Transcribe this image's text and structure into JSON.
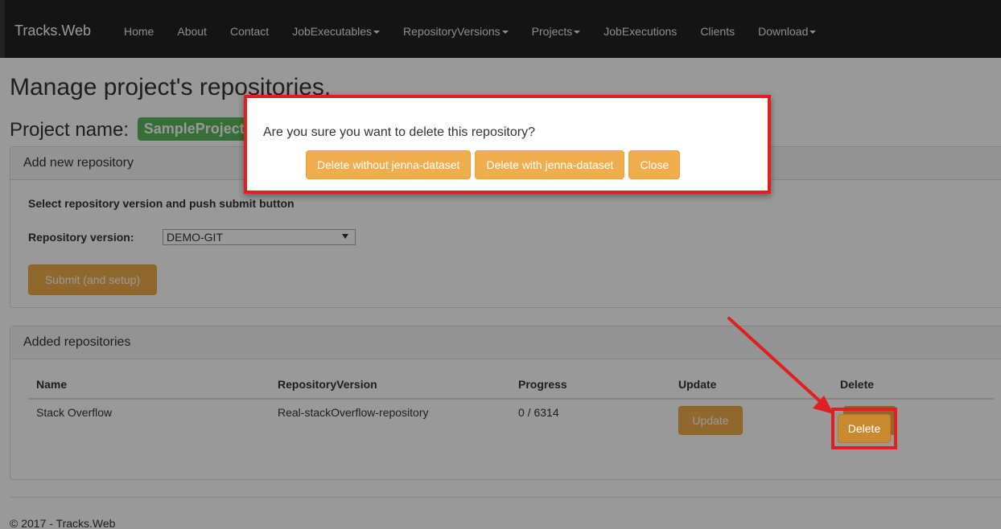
{
  "navbar": {
    "brand": "Tracks.Web",
    "items": [
      {
        "label": "Home",
        "dropdown": false
      },
      {
        "label": "About",
        "dropdown": false
      },
      {
        "label": "Contact",
        "dropdown": false
      },
      {
        "label": "JobExecutables",
        "dropdown": true
      },
      {
        "label": "RepositoryVersions",
        "dropdown": true
      },
      {
        "label": "Projects",
        "dropdown": true
      },
      {
        "label": "JobExecutions",
        "dropdown": false
      },
      {
        "label": "Clients",
        "dropdown": false
      },
      {
        "label": "Download",
        "dropdown": true
      }
    ]
  },
  "page": {
    "title": "Manage project's repositories.",
    "project_label": "Project name:",
    "project_name": "SampleProject"
  },
  "add_panel": {
    "heading": "Add new repository",
    "hint": "Select repository version and push submit button",
    "version_label": "Repository version:",
    "version_selected": "DEMO-GIT",
    "submit_label": "Submit (and setup)"
  },
  "added_panel": {
    "heading": "Added repositories",
    "columns": [
      "Name",
      "RepositoryVersion",
      "Progress",
      "Update",
      "Delete"
    ],
    "rows": [
      {
        "name": "Stack Overflow",
        "version": "Real-stackOverflow-repository",
        "progress": "0 / 6314",
        "update_label": "Update",
        "delete_label": "Delete"
      }
    ]
  },
  "footer": {
    "text": "© 2017 - Tracks.Web"
  },
  "modal": {
    "message": "Are you sure you want to delete this repository?",
    "btn_without": "Delete without jenna-dataset",
    "btn_with": "Delete with jenna-dataset",
    "btn_close": "Close"
  },
  "colors": {
    "warning": "#f0ad4e",
    "success": "#5cb85c",
    "annotation": "#e02020"
  }
}
